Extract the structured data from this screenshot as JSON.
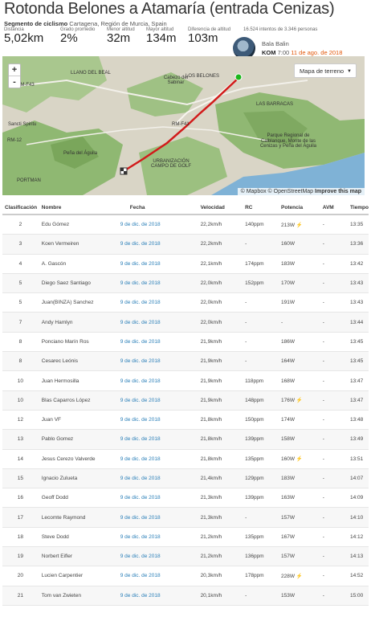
{
  "segment": {
    "title": "Rotonda Belones a Atamaría (entrada Cenizas)",
    "type_label": "Segmento de ciclismo",
    "location": "Cartagena, Región de Murcia, Spain"
  },
  "stats": [
    {
      "label": "Distancia",
      "value": "5,02km"
    },
    {
      "label": "Grado promedio",
      "value": "2%"
    },
    {
      "label": "Menor altitud",
      "value": "32m"
    },
    {
      "label": "Mayor altitud",
      "value": "134m"
    },
    {
      "label": "Diferencia de altitud",
      "value": "103m"
    }
  ],
  "attempts": "16.524 intentos de 3.346 personas",
  "kom": {
    "name": "Bala Balin",
    "label": "KOM",
    "time": "7:00",
    "date": "11 de ago. de 2018"
  },
  "map": {
    "zoom_in": "+",
    "zoom_out": "-",
    "map_type": "Mapa de terreno",
    "attribution_copy": "© Mapbox © OpenStreetMap",
    "attribution_link": "Improve this map",
    "labels": {
      "cabezo": "Cabezo del Sabinar",
      "belones": "LOS BELONES",
      "barracas": "LAS BARRACAS",
      "spiritu": "Sancti Spiritu",
      "aguila": "Peña del Águila",
      "parque": "Parque Regional de Calblanque, Monte de las Cenizas y Peña del Águila",
      "urban": "URBANIZACIÓN CAMPO DE GOLF",
      "llano": "LLANO DEL BEAL",
      "portman": "PORTMAN",
      "road1": "RM-F41",
      "road2": "RM-F43",
      "road3": "RM-12"
    }
  },
  "table": {
    "headers": {
      "rank": "Clasificación",
      "name": "Nombre",
      "date": "Fecha",
      "speed": "Velocidad",
      "hr": "RC",
      "power": "Potencia",
      "vam": "AVM",
      "time": "Tiempo"
    },
    "rows": [
      {
        "rank": "2",
        "name": "Edu Gómez",
        "date": "9 de dic. de 2018",
        "speed": "22,2km/h",
        "hr": "140ppm",
        "power": "213W ⚡",
        "vam": "-",
        "time": "13:35"
      },
      {
        "rank": "3",
        "name": "Koen Vermeiren",
        "date": "9 de dic. de 2018",
        "speed": "22,2km/h",
        "hr": "-",
        "power": "160W",
        "vam": "-",
        "time": "13:36"
      },
      {
        "rank": "4",
        "name": "A. Gascón",
        "date": "9 de dic. de 2018",
        "speed": "22,1km/h",
        "hr": "174ppm",
        "power": "183W",
        "vam": "-",
        "time": "13:42"
      },
      {
        "rank": "5",
        "name": "Diego Saez Santiago",
        "date": "9 de dic. de 2018",
        "speed": "22,0km/h",
        "hr": "152ppm",
        "power": "170W",
        "vam": "-",
        "time": "13:43"
      },
      {
        "rank": "5",
        "name": "Juan(BINZA) Sanchez",
        "date": "9 de dic. de 2018",
        "speed": "22,0km/h",
        "hr": "-",
        "power": "191W",
        "vam": "-",
        "time": "13:43"
      },
      {
        "rank": "7",
        "name": "Andy Hamlyn",
        "date": "9 de dic. de 2018",
        "speed": "22,0km/h",
        "hr": "-",
        "power": "-",
        "vam": "-",
        "time": "13:44"
      },
      {
        "rank": "8",
        "name": "Ponciano Marín Ros",
        "date": "9 de dic. de 2018",
        "speed": "21,9km/h",
        "hr": "-",
        "power": "186W",
        "vam": "-",
        "time": "13:45"
      },
      {
        "rank": "8",
        "name": "Cesarec Leónis",
        "date": "9 de dic. de 2018",
        "speed": "21,9km/h",
        "hr": "-",
        "power": "164W",
        "vam": "-",
        "time": "13:45"
      },
      {
        "rank": "10",
        "name": "Juan Hermosilla",
        "date": "9 de dic. de 2018",
        "speed": "21,9km/h",
        "hr": "118ppm",
        "power": "168W",
        "vam": "-",
        "time": "13:47"
      },
      {
        "rank": "10",
        "name": "Blas Caparros López",
        "date": "9 de dic. de 2018",
        "speed": "21,9km/h",
        "hr": "148ppm",
        "power": "176W ⚡",
        "vam": "-",
        "time": "13:47"
      },
      {
        "rank": "12",
        "name": "Juan VF",
        "date": "9 de dic. de 2018",
        "speed": "21,8km/h",
        "hr": "150ppm",
        "power": "174W",
        "vam": "-",
        "time": "13:48"
      },
      {
        "rank": "13",
        "name": "Pablo Gomez",
        "date": "9 de dic. de 2018",
        "speed": "21,8km/h",
        "hr": "139ppm",
        "power": "158W",
        "vam": "-",
        "time": "13:49"
      },
      {
        "rank": "14",
        "name": "Jesus Cerezo Valverde",
        "date": "9 de dic. de 2018",
        "speed": "21,8km/h",
        "hr": "135ppm",
        "power": "160W ⚡",
        "vam": "-",
        "time": "13:51"
      },
      {
        "rank": "15",
        "name": "Ignacio Zulueta",
        "date": "9 de dic. de 2018",
        "speed": "21,4km/h",
        "hr": "129ppm",
        "power": "183W",
        "vam": "-",
        "time": "14:07"
      },
      {
        "rank": "16",
        "name": "Geoff Dodd",
        "date": "9 de dic. de 2018",
        "speed": "21,3km/h",
        "hr": "139ppm",
        "power": "163W",
        "vam": "-",
        "time": "14:09"
      },
      {
        "rank": "17",
        "name": "Lecomte Raymond",
        "date": "9 de dic. de 2018",
        "speed": "21,3km/h",
        "hr": "-",
        "power": "157W",
        "vam": "-",
        "time": "14:10"
      },
      {
        "rank": "18",
        "name": "Steve Dodd",
        "date": "9 de dic. de 2018",
        "speed": "21,2km/h",
        "hr": "135ppm",
        "power": "167W",
        "vam": "-",
        "time": "14:12"
      },
      {
        "rank": "19",
        "name": "Norbert Eifler",
        "date": "9 de dic. de 2018",
        "speed": "21,2km/h",
        "hr": "136ppm",
        "power": "157W",
        "vam": "-",
        "time": "14:13"
      },
      {
        "rank": "20",
        "name": "Lucien Carpentier",
        "date": "9 de dic. de 2018",
        "speed": "20,3km/h",
        "hr": "178ppm",
        "power": "228W ⚡",
        "vam": "-",
        "time": "14:52"
      },
      {
        "rank": "21",
        "name": "Tom van Zwieten",
        "date": "9 de dic. de 2018",
        "speed": "20,1km/h",
        "hr": "-",
        "power": "153W",
        "vam": "-",
        "time": "15:00"
      }
    ]
  },
  "colors": {
    "accent": "#fc4c02",
    "route": "#d21a1a",
    "link": "#2a7fb8",
    "start": "#1cb61c"
  }
}
